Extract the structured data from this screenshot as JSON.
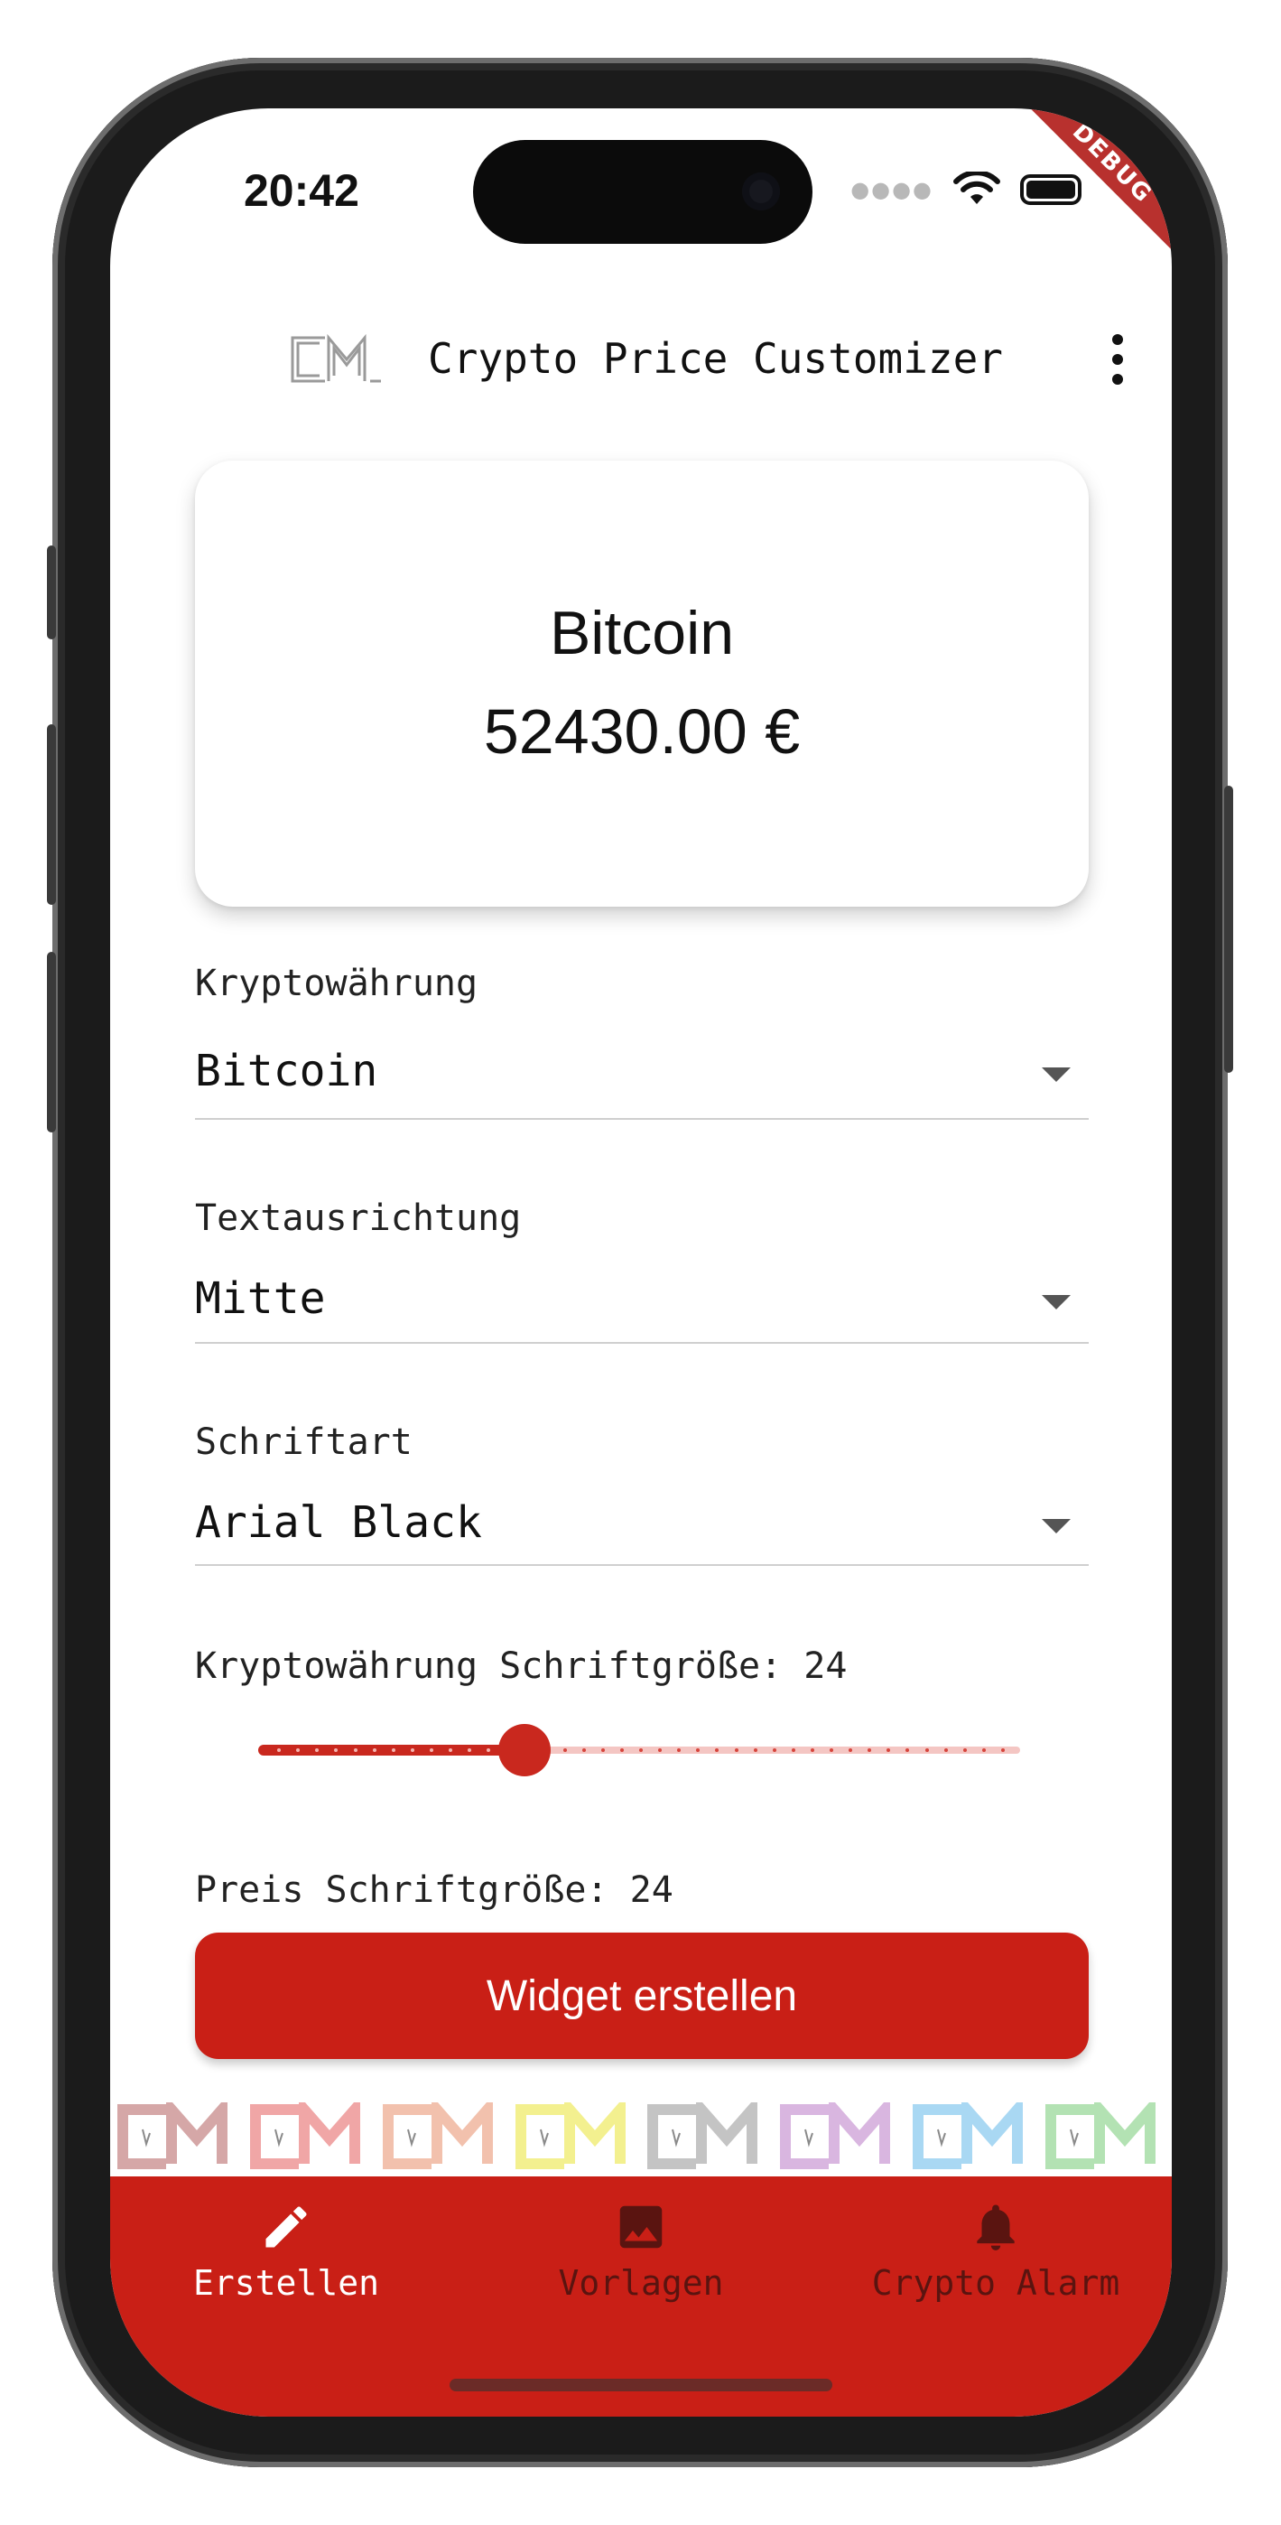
{
  "status_bar": {
    "time": "20:42",
    "debug_banner": "DEBUG"
  },
  "app_bar": {
    "title": "Crypto Price Customizer",
    "menu_icon": "more-vert-icon"
  },
  "preview": {
    "crypto_name": "Bitcoin",
    "price": "52430.00 €"
  },
  "form": {
    "crypto": {
      "label": "Kryptowährung",
      "value": "Bitcoin"
    },
    "alignment": {
      "label": "Textausrichtung",
      "value": "Mitte"
    },
    "font": {
      "label": "Schriftart",
      "value": "Arial Black"
    },
    "crypto_font_size": {
      "label": "Kryptowährung Schriftgröße: 24",
      "value": 24,
      "min": 10,
      "max": 50,
      "fraction": 0.35
    },
    "price_font_size": {
      "label": "Preis Schriftgröße: 24",
      "value": 24
    },
    "submit_label": "Widget erstellen"
  },
  "logo_strip_colors": [
    "#d5a7a7",
    "#f0a6a6",
    "#f2c1ad",
    "#f3f08f",
    "#c4c4c4",
    "#d9b6e0",
    "#a9d8f3",
    "#b3e2b3"
  ],
  "bottom_nav": {
    "items": [
      {
        "label": "Erstellen",
        "icon": "pencil-icon",
        "active": true
      },
      {
        "label": "Vorlagen",
        "icon": "image-icon",
        "active": false
      },
      {
        "label": "Crypto Alarm",
        "icon": "bell-icon",
        "active": false
      }
    ]
  },
  "colors": {
    "accent": "#c91f16",
    "accent_light": "#f4c6c3",
    "inactive_nav": "#5a1410",
    "active_nav": "#ffffff"
  }
}
